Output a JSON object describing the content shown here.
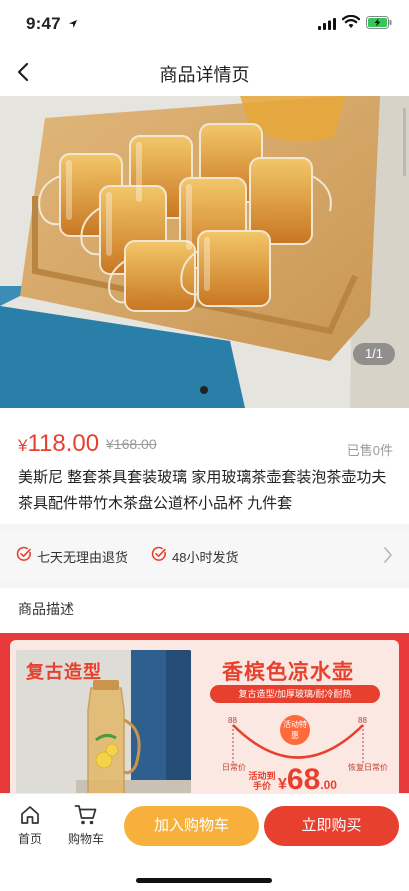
{
  "status": {
    "time": "9:47"
  },
  "nav": {
    "title": "商品详情页"
  },
  "gallery": {
    "counter": "1/1"
  },
  "product": {
    "currency": "¥",
    "price": "118.00",
    "original_price": "¥168.00",
    "sold": "已售0件",
    "title": "美斯尼 整套茶具套装玻璃 家用玻璃茶壶套装泡茶壶功夫茶具配件带竹木茶盘公道杯小品杯 九件套"
  },
  "services": [
    {
      "label": "七天无理由退货"
    },
    {
      "label": "48小时发货"
    }
  ],
  "description": {
    "label": "商品描述"
  },
  "banner": {
    "tag": "复古造型",
    "headline": "香槟色凉水壶",
    "features": "复古造型/加厚玻璃/耐冷耐热",
    "scale_left": "88",
    "scale_right": "88",
    "daily_left": "日常价",
    "daily_right": "恢复日常价",
    "badge": "活动特惠",
    "price_label": "活动到手价",
    "price_currency": "¥",
    "price_int": "68",
    "price_dec": ".00"
  },
  "bottom_bar": {
    "home": "首页",
    "cart": "购物车",
    "add_to_cart": "加入购物车",
    "buy_now": "立即购买"
  },
  "colors": {
    "accent_red": "#e8402e",
    "accent_orange": "#f7b03b"
  }
}
